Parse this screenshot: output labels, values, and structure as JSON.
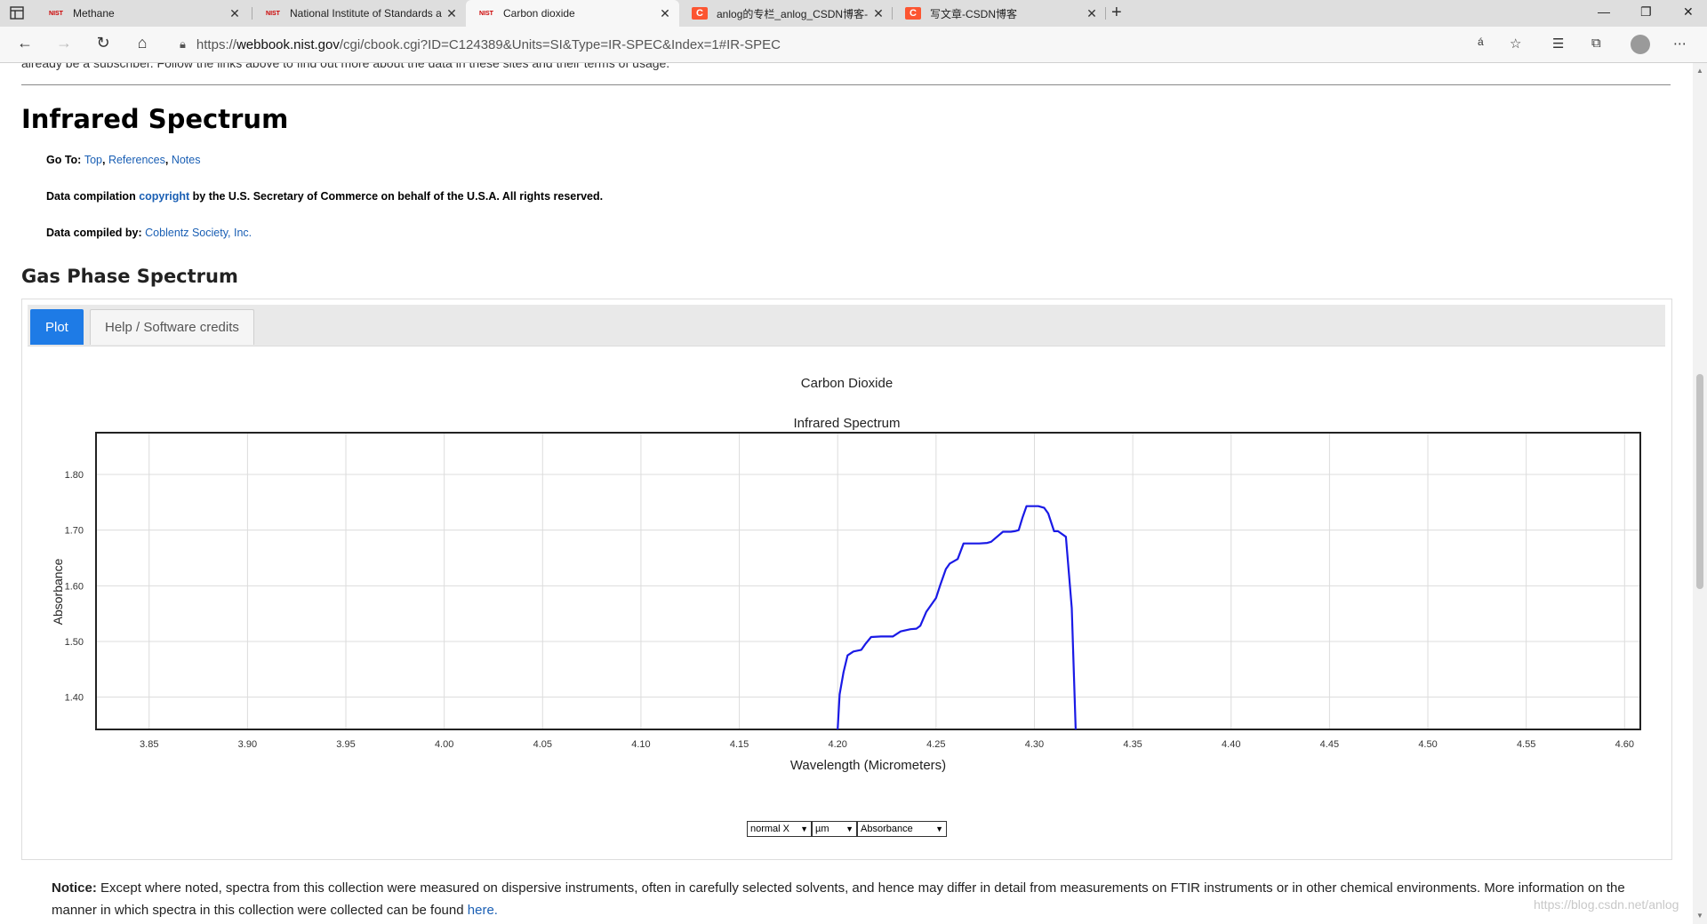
{
  "browser": {
    "tabs": [
      {
        "favicon": "NIST",
        "title": "Methane"
      },
      {
        "favicon": "NIST",
        "title": "National Institute of Standards a"
      },
      {
        "favicon": "NIST",
        "title": "Carbon dioxide",
        "active": true
      },
      {
        "favicon": "C",
        "title": "anlog的专栏_anlog_CSDN博客-"
      },
      {
        "favicon": "C",
        "title": "写文章-CSDN博客"
      }
    ],
    "close_glyph": "✕",
    "new_tab_glyph": "+",
    "url_prefix": "https://",
    "url_host": "webbook.nist.gov",
    "url_path": "/cgi/cbook.cgi?ID=C124389&Units=SI&Type=IR-SPEC&Index=1#IR-SPEC"
  },
  "page": {
    "cut_text": "already be a subscriber. Follow the links above to find out more about the data in these sites and their terms of usage.",
    "heading": "Infrared Spectrum",
    "goto_label": "Go To:",
    "goto_links": [
      "Top",
      "References",
      "Notes"
    ],
    "copyright_pre": "Data compilation",
    "copyright_link": "copyright",
    "copyright_post": "by the U.S. Secretary of Commerce on behalf of the U.S.A. All rights reserved.",
    "compiled_label": "Data compiled by:",
    "compiled_link": "Coblentz Society, Inc.",
    "section_heading": "Gas Phase Spectrum",
    "tab_plot": "Plot",
    "tab_help": "Help / Software credits",
    "select_x": "normal X",
    "select_unit": "µm",
    "select_y": "Absorbance",
    "notice_label": "Notice:",
    "notice_text": "Except where noted, spectra from this collection were measured on dispersive instruments, often in carefully selected solvents, and hence may differ in detail from measurements on FTIR instruments or in other chemical environments. More information on the manner in which spectra in this collection were collected can be found",
    "notice_link": "here.",
    "watermark": "https://blog.csdn.net/anlog"
  },
  "chart_data": {
    "type": "line",
    "title": "Carbon Dioxide",
    "subtitle": "Infrared Spectrum",
    "xlabel": "Wavelength (Micrometers)",
    "ylabel": "Absorbance",
    "xlim": [
      3.823,
      4.608
    ],
    "ylim": [
      1.342,
      1.875
    ],
    "x_ticks": [
      "3.85",
      "3.90",
      "3.95",
      "4.00",
      "4.05",
      "4.10",
      "4.15",
      "4.20",
      "4.25",
      "4.30",
      "4.35",
      "4.40",
      "4.45",
      "4.50",
      "4.55",
      "4.60"
    ],
    "y_ticks": [
      "1.40",
      "1.50",
      "1.60",
      "1.70",
      "1.80"
    ],
    "grid": true,
    "color": "#1a1ae6",
    "series": [
      {
        "x": [
          4.2,
          4.201,
          4.203,
          4.205,
          4.208,
          4.212,
          4.214,
          4.217,
          4.222,
          4.228,
          4.232,
          4.237,
          4.24,
          4.242,
          4.245,
          4.247,
          4.25,
          4.252,
          4.255,
          4.257,
          4.261,
          4.264,
          4.268,
          4.272,
          4.276,
          4.278,
          4.281,
          4.284,
          4.288,
          4.29,
          4.292,
          4.294,
          4.296,
          4.298,
          4.3,
          4.302,
          4.305,
          4.307,
          4.31,
          4.312,
          4.316,
          4.319,
          4.321
        ],
        "y": [
          1.342,
          1.405,
          1.445,
          1.475,
          1.482,
          1.485,
          1.495,
          1.508,
          1.509,
          1.509,
          1.518,
          1.522,
          1.523,
          1.528,
          1.553,
          1.563,
          1.578,
          1.6,
          1.63,
          1.64,
          1.648,
          1.676,
          1.676,
          1.676,
          1.677,
          1.679,
          1.688,
          1.697,
          1.697,
          1.698,
          1.7,
          1.723,
          1.743,
          1.743,
          1.743,
          1.743,
          1.74,
          1.73,
          1.698,
          1.698,
          1.688,
          1.56,
          1.342
        ]
      }
    ]
  }
}
